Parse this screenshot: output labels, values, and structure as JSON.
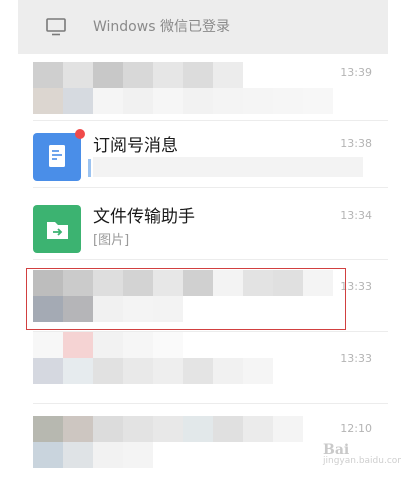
{
  "login_bar": {
    "icon": "monitor-icon",
    "text": "Windows 微信已登录"
  },
  "chats": [
    {
      "name": "",
      "preview": "",
      "time": "13:39",
      "avatar": "blurred"
    },
    {
      "name": "订阅号消息",
      "preview": "",
      "time": "13:38",
      "avatar": "article-icon",
      "unread_dot": true
    },
    {
      "name": "文件传输助手",
      "preview": "[图片]",
      "time": "13:34",
      "avatar": "folder-arrow-icon"
    },
    {
      "name": "",
      "preview": "",
      "time": "13:33",
      "avatar": "blurred",
      "highlighted": true
    },
    {
      "name": "",
      "preview": "",
      "time": "13:33",
      "avatar": "blurred"
    },
    {
      "name": "",
      "preview": "",
      "time": "12:10",
      "avatar": "blurred"
    }
  ],
  "watermark": {
    "text": "Bai",
    "sub": "jingyan.baidu.com"
  },
  "colors": {
    "login_bar_bg": "#ededed",
    "highlight": "#d14040",
    "article_avatar": "#4a8ee8",
    "file_avatar": "#3cb371",
    "unread_dot": "#f04a4a"
  }
}
